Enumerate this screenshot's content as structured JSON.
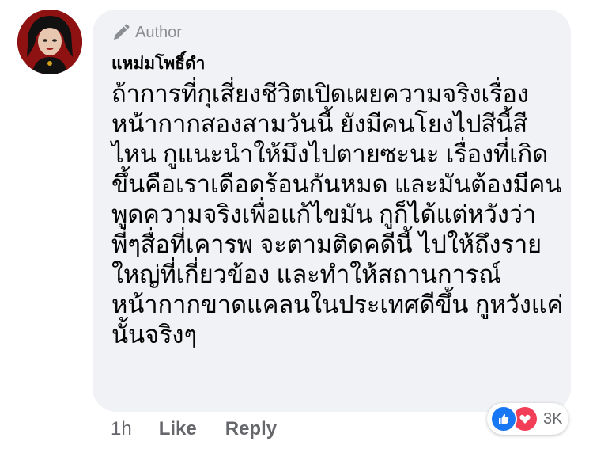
{
  "comment": {
    "author_badge": "Author",
    "author_name": "แหม่มโพธิ์ดำ",
    "text_lines": [
      "ถ้าการที่กุเสี่ยงชีวิตเปิดเผยความจริงเรื่อง",
      "หน้ากากสองสามวันนี้ ยังมีคนโยงไปสีนี้สี",
      "ไหน กูแนะนำให้มึงไปตายซะนะ เรื่องที่เกิด",
      "ขึ้นคือเราเดือดร้อนกันหมด และมันต้องมีคน",
      "พูดความจริงเพื่อแก้ไขมัน กูก็ได้แต่หวังว่า",
      "พี่ๆสื่อที่เคารพ จะตามติดคดีนี้ ไปให้ถึงราย",
      "ใหญ่ที่เกี่ยวข้อง และทำให้สถานการณ์",
      "หน้ากากขาดแคลนในประเทศดีขึ้น กูหวังแค่",
      "นั้นจริงๆ"
    ]
  },
  "actions": {
    "time": "1h",
    "like": "Like",
    "reply": "Reply"
  },
  "reactions": {
    "count": "3K",
    "icons": [
      "like-icon",
      "love-icon"
    ],
    "colors": {
      "like": "#1877f2",
      "love": "#f33e58"
    }
  }
}
